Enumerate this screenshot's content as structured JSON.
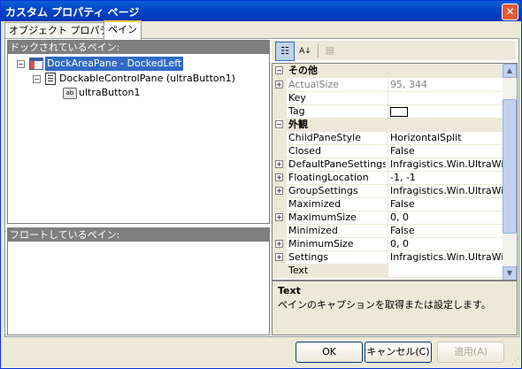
{
  "window": {
    "title": "カスタム プロパティ ページ"
  },
  "tabs": [
    {
      "label": "オブジェクト プロパティ"
    },
    {
      "label": "ペイン"
    }
  ],
  "docked_panel": {
    "header": "ドックされているペイン:",
    "tree": [
      {
        "label": "DockAreaPane - DockedLeft",
        "icon": "dock-area-icon",
        "expanded": true,
        "selected": true
      },
      {
        "label": "DockableControlPane (ultraButton1)",
        "icon": "pane-icon",
        "expanded": true
      },
      {
        "label": "ultraButton1",
        "icon": "button-control-icon"
      }
    ]
  },
  "floating_panel": {
    "header": "フロートしているペイン:"
  },
  "toolbar": {
    "categorized_icon": "categorized-icon",
    "alphabetical_icon": "alphabetical-icon",
    "property_pages_icon": "property-pages-icon"
  },
  "property_grid": {
    "rows": [
      {
        "type": "category",
        "name": "その他"
      },
      {
        "name": "ActualSize",
        "value": "95, 344",
        "expandable": true,
        "readonly": true
      },
      {
        "name": "Key",
        "value": ""
      },
      {
        "name": "Tag",
        "value": "",
        "value_box": true
      },
      {
        "type": "category",
        "name": "外観"
      },
      {
        "name": "ChildPaneStyle",
        "value": "HorizontalSplit"
      },
      {
        "name": "Closed",
        "value": "False"
      },
      {
        "name": "DefaultPaneSettings",
        "value": "Infragistics.Win.UltraWinD",
        "expandable": true
      },
      {
        "name": "FloatingLocation",
        "value": "-1, -1",
        "expandable": true
      },
      {
        "name": "GroupSettings",
        "value": "Infragistics.Win.UltraWinD",
        "expandable": true
      },
      {
        "name": "Maximized",
        "value": "False"
      },
      {
        "name": "MaximumSize",
        "value": "0, 0",
        "expandable": true
      },
      {
        "name": "Minimized",
        "value": "False"
      },
      {
        "name": "MinimumSize",
        "value": "0, 0",
        "expandable": true
      },
      {
        "name": "Settings",
        "value": "Infragistics.Win.UltraWinD",
        "expandable": true
      },
      {
        "name": "Text",
        "value": "",
        "selected": true
      }
    ]
  },
  "description": {
    "title": "Text",
    "text": "ペインのキャプションを取得または設定します。"
  },
  "buttons": {
    "ok": "OK",
    "cancel": "キャンセル(C)",
    "apply": "適用(A)"
  },
  "colors": {
    "titlebar": "#0347c8",
    "selection": "#316ac5",
    "panel_header": "#7f7f7f",
    "tab_highlight": "#ffc83c"
  }
}
